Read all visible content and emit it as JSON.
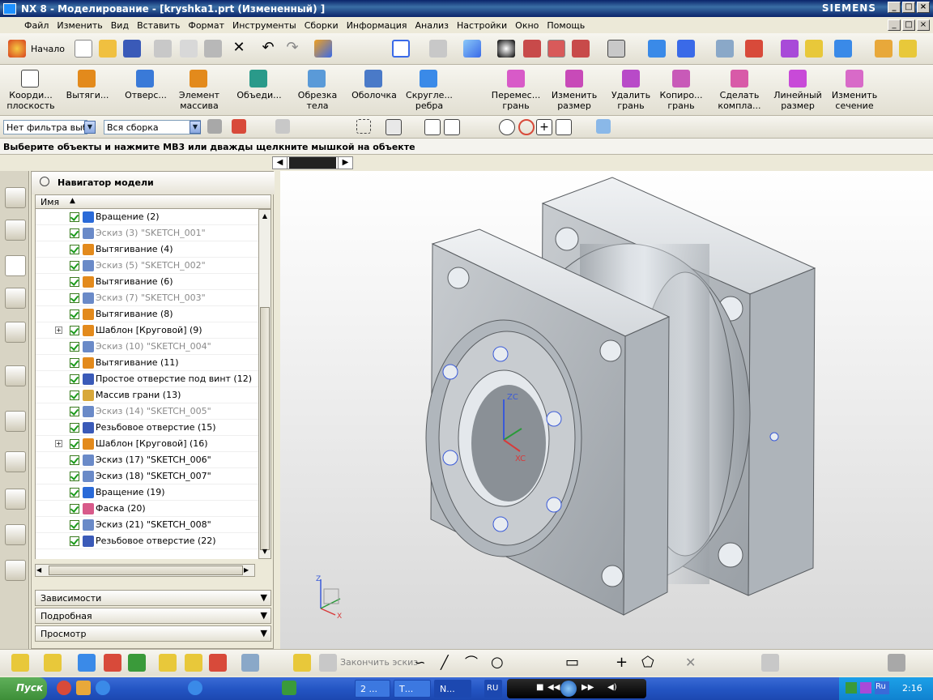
{
  "window": {
    "title": "NX 8 - Моделирование - [kryshka1.prt (Измененный) ]",
    "brand": "SIEMENS",
    "controls": [
      "_",
      "□",
      "×"
    ]
  },
  "menu": {
    "items": [
      "Файл",
      "Изменить",
      "Вид",
      "Вставить",
      "Формат",
      "Инструменты",
      "Сборки",
      "Информация",
      "Анализ",
      "Настройки",
      "Окно",
      "Помощь"
    ]
  },
  "toolbar1": {
    "start_label": "Начало"
  },
  "toolbar2": {
    "left": [
      {
        "label1": "Коорди...",
        "label2": "плоскость",
        "color": "#ffffff"
      },
      {
        "label1": "Вытяги...",
        "label2": "",
        "color": "#e38a1c"
      },
      {
        "label1": "Отверс...",
        "label2": "",
        "color": "#3a7ad8"
      },
      {
        "label1": "Элемент",
        "label2": "массива",
        "color": "#e38a1c"
      },
      {
        "label1": "Объеди...",
        "label2": "",
        "color": "#2a9a8a"
      },
      {
        "label1": "Обрезка",
        "label2": "тела",
        "color": "#5a9ad8"
      },
      {
        "label1": "Оболочка",
        "label2": "",
        "color": "#4a7ac8"
      },
      {
        "label1": "Скругле...",
        "label2": "ребра",
        "color": "#3a8ae8"
      }
    ],
    "right": [
      {
        "label1": "Перемес...",
        "label2": "грань",
        "color": "#d85ac8"
      },
      {
        "label1": "Изменить",
        "label2": "размер",
        "color": "#c84ab8"
      },
      {
        "label1": "Удалить",
        "label2": "грань",
        "color": "#b84ac8"
      },
      {
        "label1": "Копиро...",
        "label2": "грань",
        "color": "#c85ab8"
      },
      {
        "label1": "Сделать",
        "label2": "компла...",
        "color": "#d85aa8"
      },
      {
        "label1": "Линейный",
        "label2": "размер",
        "color": "#c84ad8"
      },
      {
        "label1": "Изменить",
        "label2": "сечение",
        "color": "#d86ac8"
      }
    ]
  },
  "filters": {
    "type_filter": "Нет фильтра выбо",
    "scope_filter": "Вся сборка"
  },
  "status": {
    "prompt": "Выберите объекты и нажмите MB3 или дважды щелкните мышкой на объекте"
  },
  "navigator": {
    "title": "Навигатор модели",
    "column": "Имя",
    "rows": [
      {
        "text": "Вращение (2)",
        "grey": false,
        "icon": "revolve-icon",
        "color": "#2a6ad8",
        "expand": ""
      },
      {
        "text": "Эскиз (3) \"SKETCH_001\"",
        "grey": true,
        "icon": "sketch-icon",
        "color": "#6a8ac8",
        "expand": ""
      },
      {
        "text": "Вытягивание (4)",
        "grey": false,
        "icon": "extrude-icon",
        "color": "#e38a1c",
        "expand": ""
      },
      {
        "text": "Эскиз (5) \"SKETCH_002\"",
        "grey": true,
        "icon": "sketch-icon",
        "color": "#6a8ac8",
        "expand": ""
      },
      {
        "text": "Вытягивание (6)",
        "grey": false,
        "icon": "extrude-icon",
        "color": "#e38a1c",
        "expand": ""
      },
      {
        "text": "Эскиз (7) \"SKETCH_003\"",
        "grey": true,
        "icon": "sketch-icon",
        "color": "#6a8ac8",
        "expand": ""
      },
      {
        "text": "Вытягивание (8)",
        "grey": false,
        "icon": "extrude-icon",
        "color": "#e38a1c",
        "expand": ""
      },
      {
        "text": "Шаблон [Круговой] (9)",
        "grey": false,
        "icon": "pattern-icon",
        "color": "#e38a1c",
        "expand": "+"
      },
      {
        "text": "Эскиз (10) \"SKETCH_004\"",
        "grey": true,
        "icon": "sketch-icon",
        "color": "#6a8ac8",
        "expand": ""
      },
      {
        "text": "Вытягивание (11)",
        "grey": false,
        "icon": "extrude-icon",
        "color": "#e38a1c",
        "expand": ""
      },
      {
        "text": "Простое отверстие под винт (12)",
        "grey": false,
        "icon": "hole-icon",
        "color": "#3a5ab8",
        "expand": ""
      },
      {
        "text": "Массив грани (13)",
        "grey": false,
        "icon": "face-array-icon",
        "color": "#d8a83a",
        "expand": ""
      },
      {
        "text": "Эскиз (14) \"SKETCH_005\"",
        "grey": true,
        "icon": "sketch-icon",
        "color": "#6a8ac8",
        "expand": ""
      },
      {
        "text": "Резьбовое отверстие (15)",
        "grey": false,
        "icon": "threaded-hole-icon",
        "color": "#3a5ab8",
        "expand": ""
      },
      {
        "text": "Шаблон [Круговой] (16)",
        "grey": false,
        "icon": "pattern-icon",
        "color": "#e38a1c",
        "expand": "+"
      },
      {
        "text": "Эскиз (17) \"SKETCH_006\"",
        "grey": false,
        "icon": "sketch-icon",
        "color": "#6a8ac8",
        "expand": ""
      },
      {
        "text": "Эскиз (18) \"SKETCH_007\"",
        "grey": false,
        "icon": "sketch-icon",
        "color": "#6a8ac8",
        "expand": ""
      },
      {
        "text": "Вращение (19)",
        "grey": false,
        "icon": "revolve-icon",
        "color": "#2a6ad8",
        "expand": ""
      },
      {
        "text": "Фаска (20)",
        "grey": false,
        "icon": "chamfer-icon",
        "color": "#d85a8a",
        "expand": ""
      },
      {
        "text": "Эскиз (21) \"SKETCH_008\"",
        "grey": false,
        "icon": "sketch-icon",
        "color": "#6a8ac8",
        "expand": ""
      },
      {
        "text": "Резьбовое отверстие (22)",
        "grey": false,
        "icon": "threaded-hole-icon",
        "color": "#3a5ab8",
        "expand": ""
      }
    ],
    "sections": [
      "Зависимости",
      "Подробная",
      "Просмотр"
    ]
  },
  "viewport": {
    "axis_z": "ZC",
    "axis_x": "XC",
    "triad_z": "Z",
    "triad_x": "X"
  },
  "bottom_toolbar": {
    "finish_sketch": "Закончить эскиз"
  },
  "taskbar": {
    "start": "Пуск",
    "tasks": [
      "2 ...",
      "Т...",
      "N..."
    ],
    "lang": "RU",
    "tray_lang": "Ru",
    "clock": "2:16"
  }
}
